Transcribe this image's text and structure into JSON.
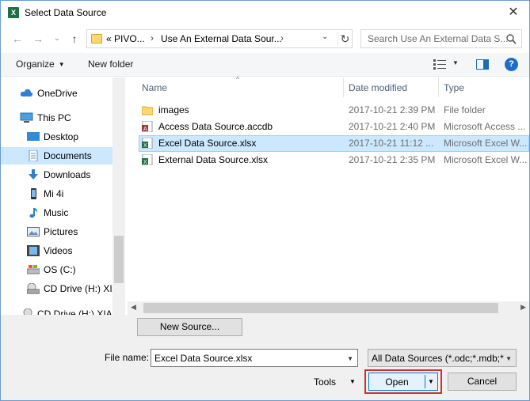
{
  "window": {
    "title": "Select Data Source",
    "app_icon": "excel-icon",
    "close_label": "✕"
  },
  "address": {
    "crumbs": [
      "«  PIVO...",
      "Use An External Data Sour..."
    ],
    "separator": "›",
    "back_glyph": "←",
    "forward_glyph": "→",
    "recent_glyph": "⌄",
    "up_glyph": "↑",
    "dropdown_glyph": "⌄",
    "refresh_glyph": "↻"
  },
  "search": {
    "placeholder": "Search Use An External Data S..."
  },
  "toolbar": {
    "organize_label": "Organize",
    "new_folder_label": "New folder",
    "help_label": "?"
  },
  "nav": {
    "items": [
      {
        "label": "OneDrive",
        "icon": "cloud-icon",
        "selected": false
      },
      {
        "label": "This PC",
        "icon": "computer-icon",
        "selected": false
      },
      {
        "label": "Desktop",
        "icon": "desktop-icon",
        "selected": false
      },
      {
        "label": "Documents",
        "icon": "documents-icon",
        "selected": true
      },
      {
        "label": "Downloads",
        "icon": "download-icon",
        "selected": false
      },
      {
        "label": "Mi 4i",
        "icon": "phone-icon",
        "selected": false
      },
      {
        "label": "Music",
        "icon": "music-icon",
        "selected": false
      },
      {
        "label": "Pictures",
        "icon": "pictures-icon",
        "selected": false
      },
      {
        "label": "Videos",
        "icon": "videos-icon",
        "selected": false
      },
      {
        "label": "OS (C:)",
        "icon": "drive-icon",
        "selected": false
      },
      {
        "label": "CD Drive (H:) XIA",
        "icon": "cd-drive-icon",
        "selected": false
      },
      {
        "label": "CD Drive (H:) XIA",
        "icon": "cd-drive-icon",
        "selected": false
      }
    ]
  },
  "files": {
    "columns": [
      "Name",
      "Date modified",
      "Type"
    ],
    "sort_glyph": "^",
    "rows": [
      {
        "name": "images",
        "date": "2017-10-21 2:39 PM",
        "type": "File folder",
        "icon": "folder-icon",
        "selected": false
      },
      {
        "name": "Access Data Source.accdb",
        "date": "2017-10-21 2:40 PM",
        "type": "Microsoft Access ...",
        "icon": "access-file-icon",
        "selected": false
      },
      {
        "name": "Excel Data Source.xlsx",
        "date": "2017-10-21 11:12 ...",
        "type": "Microsoft Excel W...",
        "icon": "excel-file-icon",
        "selected": true
      },
      {
        "name": "External Data Source.xlsx",
        "date": "2017-10-21 2:35 PM",
        "type": "Microsoft Excel W...",
        "icon": "excel-file-icon",
        "selected": false
      }
    ]
  },
  "bottom": {
    "new_source_label": "New Source...",
    "file_name_label": "File name:",
    "file_name_value": "Excel Data Source.xlsx",
    "filter_value": "All Data Sources (*.odc;*.mdb;*",
    "tools_label": "Tools",
    "open_label": "Open",
    "cancel_label": "Cancel"
  },
  "colors": {
    "selection": "#cce8ff",
    "accent": "#0078d7",
    "highlight_border": "#d0312d",
    "excel_green": "#1e7145"
  }
}
